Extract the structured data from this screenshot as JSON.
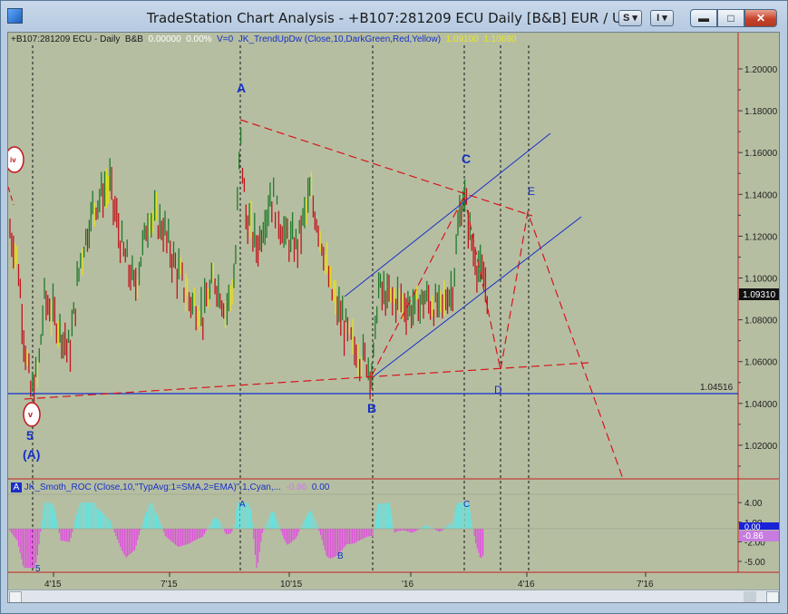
{
  "window": {
    "title": "TradeStation Chart Analysis - +B107:281209 ECU Daily [B&B] EUR / USD",
    "btn_s": "S",
    "btn_i": "I",
    "minimize_glyph": "▬",
    "maximize_glyph": "□",
    "close_glyph": "✕"
  },
  "price_panel": {
    "symbol_label": "+B107:281209 ECU - Daily",
    "strategy_label": "B&B",
    "change_value": "0.00000",
    "change_percent": "0.00%",
    "volume_label": "V=0",
    "indicator_label": "JK_TrendUpDw (Close,10,DarkGreen,Red,Yellow)",
    "indicator_value_1": "1.09100",
    "indicator_value_2": "1.10680",
    "last_price": "1.09310",
    "support_level": "1.04516",
    "y_ticks": [
      "1.20000",
      "1.18000",
      "1.16000",
      "1.14000",
      "1.12000",
      "1.10000",
      "1.08000",
      "1.06000",
      "1.04000",
      "1.02000"
    ],
    "wave_labels": {
      "A": "A",
      "B": "B",
      "C": "C",
      "D": "D",
      "E": "E",
      "five": "5",
      "wave_a_paren": "(A)",
      "iv": "iv",
      "v": "v"
    }
  },
  "roc_panel": {
    "badge": "A",
    "indicator_label": "JK_Smoth_ROC (Close,10,\"TypAvg:1=SMA,2=EMA)\",1,Cyan,...",
    "value_1": "-0.86",
    "value_2": "0.00",
    "y_ticks": [
      "4.00",
      "1.00",
      "-2.00",
      "-5.00"
    ],
    "highlight_ticks": [
      "0.00",
      "-0.86"
    ],
    "wave_labels": {
      "A": "A",
      "B": "B",
      "C": "C",
      "five": "5"
    }
  },
  "time_axis": {
    "labels": [
      "4'15",
      "7'15",
      "10'15",
      "'16",
      "4'16",
      "7'16"
    ]
  },
  "colors": {
    "chart_bg": "#b6bea2",
    "bar_green": "#1e7a2a",
    "bar_red": "#c0151b",
    "bar_yellow": "#e5e01a",
    "wave_blue": "#1430c8",
    "dash_red": "#d8141a",
    "roc_cyan": "#5ee6e6",
    "roc_magenta": "#e24ae0"
  }
}
